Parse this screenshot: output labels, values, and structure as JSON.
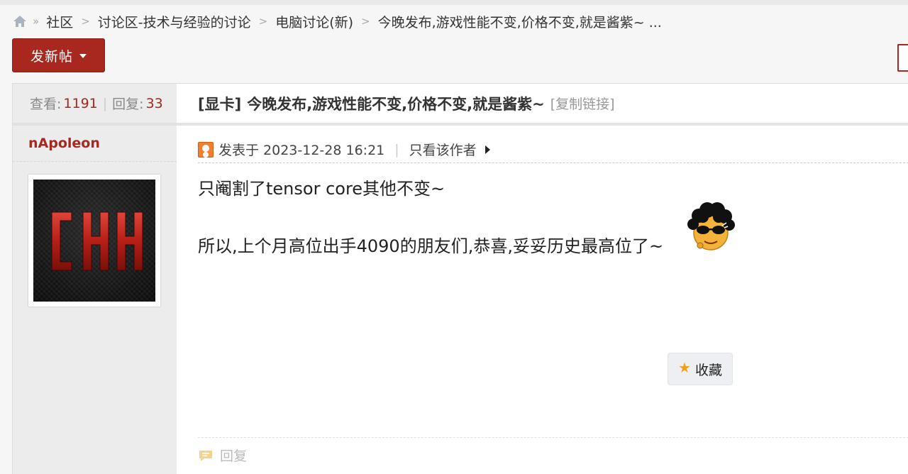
{
  "breadcrumb": {
    "items": [
      "社区",
      "讨论区-技术与经验的讨论",
      "电脑讨论(新)",
      "今晚发布,游戏性能不变,价格不变,就是酱紫~ ..."
    ]
  },
  "toolbar": {
    "new_post_label": "发新帖"
  },
  "thread": {
    "stats": {
      "views_label": "查看:",
      "views": "1191",
      "replies_label": "回复:",
      "replies": "33"
    },
    "tag": "[显卡]",
    "title": "今晚发布,游戏性能不变,价格不变,就是酱紫~",
    "copy_link": "[复制链接]"
  },
  "post": {
    "author": "nApoleon",
    "avatar_text": "CHH",
    "posted_at": "发表于 2023-12-28 16:21",
    "only_author": "只看该作者",
    "body_line1": "只阉割了tensor core其他不变~",
    "body_line2": "所以,上个月高位出手4090的朋友们,恭喜,妥妥历史最高位了~",
    "favorite_label": "收藏",
    "reply_label": "回复"
  },
  "colors": {
    "accent": "#a8271f",
    "star": "#f0a020"
  }
}
